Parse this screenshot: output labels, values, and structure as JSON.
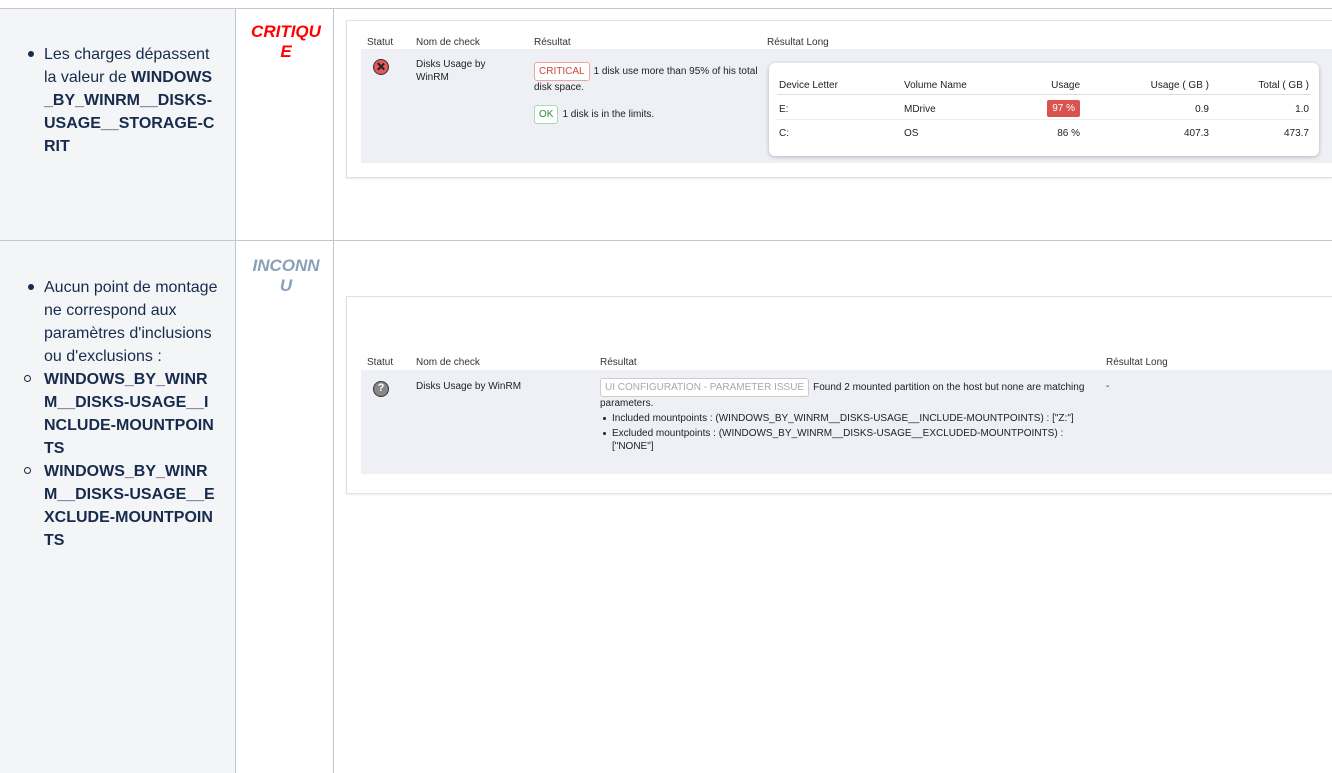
{
  "rows": [
    {
      "description": {
        "intro": "Les charges dépassent la valeur de ",
        "variable": "WINDOWS_BY_WINRM__DISKS-USAGE__STORAGE-CRIT"
      },
      "status": "CRITIQUE",
      "status_color": "#ff0000",
      "panel": {
        "headers": [
          "Statut",
          "Nom de check",
          "Résultat",
          "Résultat Long"
        ],
        "check_name": "Disks Usage by WinRM",
        "status_icon": "critical-x-icon",
        "results": [
          {
            "tag": "CRITICAL",
            "text": "1 disk use more than 95% of his total disk space."
          },
          {
            "tag": "OK",
            "text": "1 disk is in the limits."
          }
        ],
        "long_table": {
          "columns": [
            "Device Letter",
            "Volume Name",
            "Usage",
            "Usage ( GB )",
            "Total ( GB )"
          ],
          "rows": [
            [
              "E:",
              "MDrive",
              "97 %",
              "0.9",
              "1.0"
            ],
            [
              "C:",
              "OS",
              "86 %",
              "407.3",
              "473.7"
            ]
          ]
        }
      }
    },
    {
      "description": {
        "intro": "Aucun point de montage ne correspond aux paramètres d'inclusions ou d'exclusions :",
        "items": [
          "WINDOWS_BY_WINRM__DISKS-USAGE__INCLUDE-MOUNTPOINTS",
          "WINDOWS_BY_WINRM__DISKS-USAGE__EXCLUDE-MOUNTPOINTS"
        ]
      },
      "status": "INCONNU",
      "status_color": "#8aa0b8",
      "panel": {
        "headers": [
          "Statut",
          "Nom de check",
          "Résultat",
          "Résultat Long"
        ],
        "check_name": "Disks Usage by WinRM",
        "status_icon": "unknown-question-icon",
        "tag": "UI CONFIGURATION - PARAMETER ISSUE",
        "text": "Found 2 mounted partition on the host but none are matching parameters.",
        "bullets": [
          "Included mountpoints : (WINDOWS_BY_WINRM__DISKS-USAGE__INCLUDE-MOUNTPOINTS) : [\"Z:\"]",
          "Excluded mountpoints : (WINDOWS_BY_WINRM__DISKS-USAGE__EXCLUDED-MOUNTPOINTS) : [\"NONE\"]"
        ],
        "long": "-"
      }
    }
  ]
}
